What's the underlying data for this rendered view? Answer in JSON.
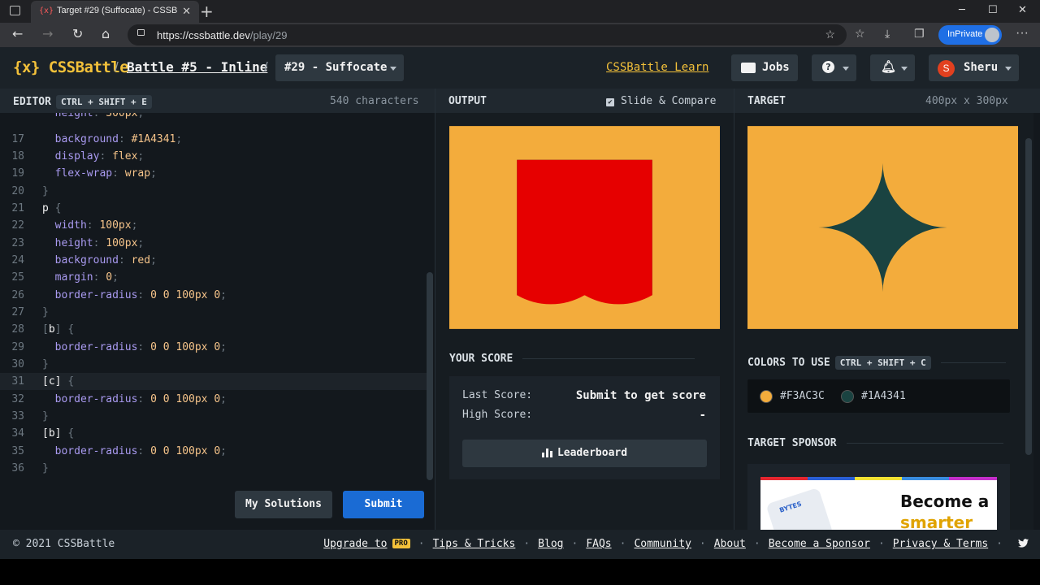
{
  "browser": {
    "tab_title": "Target #29 (Suffocate) - CSSBattl",
    "tab_favicon": "{x}",
    "url_host": "https://cssbattle.dev",
    "url_path": "/play/29",
    "inprivate_label": "InPrivate"
  },
  "header": {
    "logo": "{x} CSSBattle",
    "battle": "Battle #5 - Inline",
    "target": "#29 - Suffocate",
    "learn": "CSSBattle Learn",
    "jobs": "Jobs",
    "user_initial": "S",
    "user_name": "Sheru"
  },
  "editor": {
    "title": "EDITOR",
    "shortcut": "CTRL + SHIFT + E",
    "char_count": "540 characters",
    "my_solutions": "My Solutions",
    "submit": "Submit"
  },
  "output": {
    "title": "OUTPUT",
    "slide_compare": "Slide & Compare",
    "slide_compare_checked": true,
    "your_score": "YOUR SCORE",
    "last_score_label": "Last Score:",
    "last_score_value": "Submit to get score",
    "high_score_label": "High Score:",
    "high_score_value": "-",
    "leaderboard": "Leaderboard"
  },
  "target": {
    "title": "TARGET",
    "size": "400px x 300px",
    "colors_title": "COLORS TO USE",
    "colors_shortcut": "CTRL + SHIFT + C",
    "colors": [
      {
        "hex": "#F3AC3C"
      },
      {
        "hex": "#1A4341"
      }
    ],
    "sponsor_title": "TARGET SPONSOR",
    "ad_line1": "Become a",
    "ad_line2": "smarter",
    "ad_brand": "BYTES"
  },
  "footer": {
    "copyright": "© 2021 CSSBattle",
    "links": [
      "Upgrade to",
      "Tips & Tricks",
      "Blog",
      "FAQs",
      "Community",
      "About",
      "Become a Sponsor",
      "Privacy & Terms"
    ],
    "pro_badge": "PRO"
  },
  "colors": {
    "accent_yellow": "#f3c13a",
    "submit_blue": "#1a6bd4",
    "canvas_bg": "#F3AC3C",
    "shape": "#1A4341",
    "output_red": "#e60000"
  }
}
